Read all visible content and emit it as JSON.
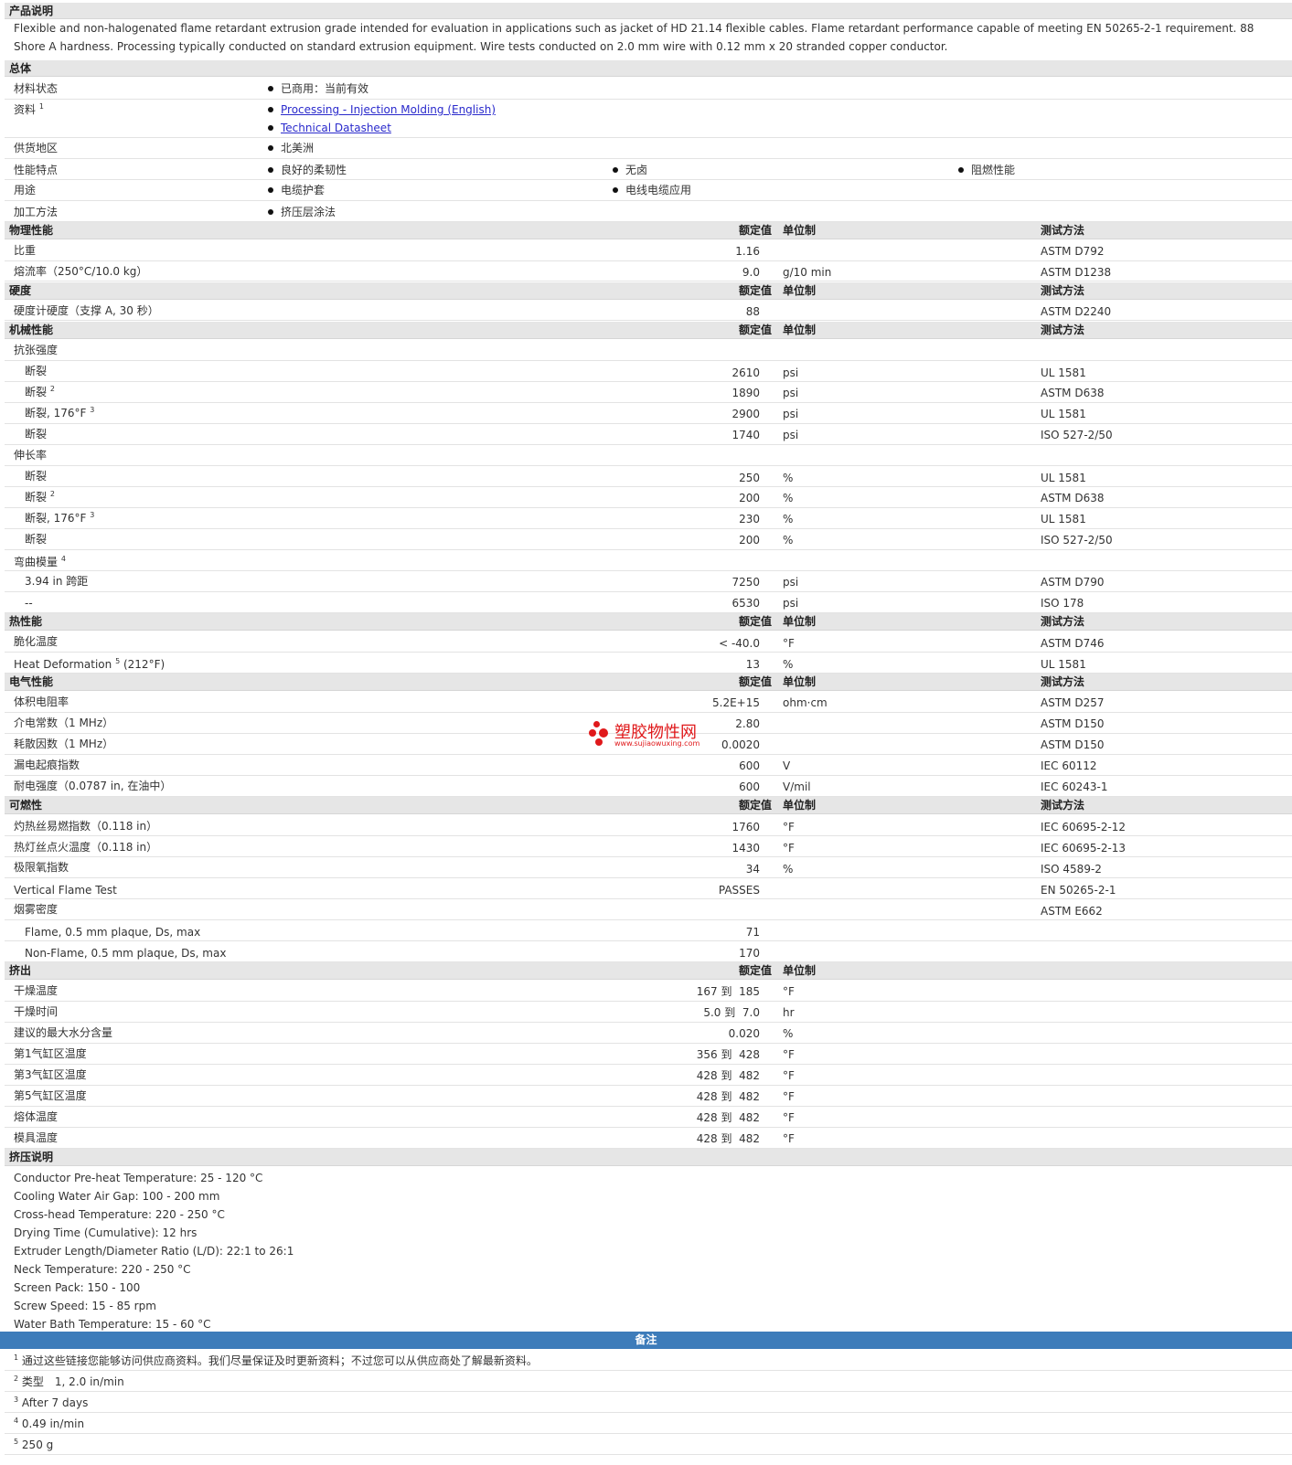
{
  "desc_header": "产品说明",
  "description": "Flexible and non-halogenated flame retardant extrusion grade intended for evaluation in applications such as jacket of HD 21.14 flexible cables. Flame retardant performance capable of meeting EN 50265-2-1 requirement. 88 Shore A hardness. Processing typically conducted on standard extrusion equipment. Wire tests conducted on 2.0 mm wire with 0.12 mm x 20 stranded copper conductor.",
  "general": {
    "title": "总体",
    "status_label": "材料状态",
    "status_value": "已商用：当前有效",
    "docs_label": "资料",
    "docs_sup": "1",
    "doc1": "Processing - Injection Molding (English)",
    "doc2": "Technical Datasheet",
    "region_label": "供货地区",
    "region_value": "北美洲",
    "features_label": "性能特点",
    "feature1": "良好的柔韧性",
    "feature2": "无卤",
    "feature3": "阻燃性能",
    "uses_label": "用途",
    "use1": "电缆护套",
    "use2": "电线电缆应用",
    "method_label": "加工方法",
    "method_value": "挤压层涂法"
  },
  "cols": {
    "nominal": "额定值",
    "unit": "单位制",
    "test": "测试方法"
  },
  "physical": {
    "title": "物理性能",
    "sg": {
      "label": "比重",
      "value": "1.16",
      "test": "ASTM D792"
    },
    "mfr": {
      "label": "熔流率（250°C/10.0 kg）",
      "value": "9.0",
      "unit": "g/10 min",
      "test": "ASTM D1238"
    }
  },
  "hardness": {
    "title": "硬度",
    "shore": {
      "label": "硬度计硬度（支撑 A, 30 秒）",
      "value": "88",
      "test": "ASTM D2240"
    }
  },
  "mechanical": {
    "title": "机械性能",
    "tensile": "抗张强度",
    "t1": {
      "label": "断裂",
      "value": "2610",
      "unit": "psi",
      "test": "UL 1581"
    },
    "t2": {
      "label": "断裂",
      "sup": "2",
      "value": "1890",
      "unit": "psi",
      "test": "ASTM D638"
    },
    "t3": {
      "label": "断裂, 176°F",
      "sup": "3",
      "value": "2900",
      "unit": "psi",
      "test": "UL 1581"
    },
    "t4": {
      "label": "断裂",
      "value": "1740",
      "unit": "psi",
      "test": "ISO 527-2/50"
    },
    "elong": "伸长率",
    "e1": {
      "label": "断裂",
      "value": "250",
      "unit": "%",
      "test": "UL 1581"
    },
    "e2": {
      "label": "断裂",
      "sup": "2",
      "value": "200",
      "unit": "%",
      "test": "ASTM D638"
    },
    "e3": {
      "label": "断裂, 176°F",
      "sup": "3",
      "value": "230",
      "unit": "%",
      "test": "UL 1581"
    },
    "e4": {
      "label": "断裂",
      "value": "200",
      "unit": "%",
      "test": "ISO 527-2/50"
    },
    "flex": "弯曲模量",
    "flex_sup": "4",
    "f1": {
      "label": "3.94 in 跨距",
      "value": "7250",
      "unit": "psi",
      "test": "ASTM D790"
    },
    "f2": {
      "label": "--",
      "value": "6530",
      "unit": "psi",
      "test": "ISO 178"
    }
  },
  "thermal": {
    "title": "热性能",
    "brittle": {
      "label": "脆化温度",
      "value": "< -40.0",
      "unit": "°F",
      "test": "ASTM D746"
    },
    "hd": {
      "label": "Heat Deformation",
      "sup": "5",
      "label2": "(212°F)",
      "value": "13",
      "unit": "%",
      "test": "UL 1581"
    }
  },
  "electrical": {
    "title": "电气性能",
    "vr": {
      "label": "体积电阻率",
      "value": "5.2E+15",
      "unit": "ohm·cm",
      "test": "ASTM D257"
    },
    "dc": {
      "label": "介电常数（1 MHz）",
      "value": "2.80",
      "test": "ASTM D150"
    },
    "df": {
      "label": "耗散因数（1 MHz）",
      "value": "0.0020",
      "test": "ASTM D150"
    },
    "cti": {
      "label": "漏电起痕指数",
      "value": "600",
      "unit": "V",
      "test": "IEC 60112"
    },
    "ds": {
      "label": "耐电强度（0.0787 in, 在油中）",
      "value": "600",
      "unit": "V/mil",
      "test": "IEC 60243-1"
    }
  },
  "flammability": {
    "title": "可燃性",
    "gwfi": {
      "label": "灼热丝易燃指数（0.118 in）",
      "value": "1760",
      "unit": "°F",
      "test": "IEC 60695-2-12"
    },
    "gwit": {
      "label": "热灯丝点火温度（0.118 in）",
      "value": "1430",
      "unit": "°F",
      "test": "IEC 60695-2-13"
    },
    "loi": {
      "label": "极限氧指数",
      "value": "34",
      "unit": "%",
      "test": "ISO 4589-2"
    },
    "vft": {
      "label": "Vertical Flame Test",
      "value": "PASSES",
      "test": "EN 50265-2-1"
    },
    "smoke": {
      "label": "烟雾密度",
      "test": "ASTM E662"
    },
    "s1": {
      "label": "Flame, 0.5 mm plaque, Ds, max",
      "value": "71"
    },
    "s2": {
      "label": "Non-Flame, 0.5 mm plaque, Ds, max",
      "value": "170"
    }
  },
  "extrusion": {
    "title": "挤出",
    "to": "到",
    "dt": {
      "label": "干燥温度",
      "v1": "167",
      "v2": "185",
      "unit": "°F"
    },
    "dtime": {
      "label": "干燥时间",
      "v1": "5.0",
      "v2": "7.0",
      "unit": "hr"
    },
    "moist": {
      "label": "建议的最大水分含量",
      "value": "0.020",
      "unit": "%"
    },
    "z1": {
      "label": "第1气缸区温度",
      "v1": "356",
      "v2": "428",
      "unit": "°F"
    },
    "z3": {
      "label": "第3气缸区温度",
      "v1": "428",
      "v2": "482",
      "unit": "°F"
    },
    "z5": {
      "label": "第5气缸区温度",
      "v1": "428",
      "v2": "482",
      "unit": "°F"
    },
    "melt": {
      "label": "熔体温度",
      "v1": "428",
      "v2": "482",
      "unit": "°F"
    },
    "die": {
      "label": "模具温度",
      "v1": "428",
      "v2": "482",
      "unit": "°F"
    }
  },
  "extrusion_notes": {
    "title": "挤压说明",
    "lines": [
      "Conductor Pre-heat Temperature: 25 - 120 °C",
      "Cooling Water Air Gap: 100 - 200 mm",
      "Cross-head Temperature: 220 - 250 °C",
      "Drying Time (Cumulative): 12 hrs",
      "Extruder Length/Diameter Ratio (L/D): 22:1 to 26:1",
      "Neck Temperature: 220 - 250 °C",
      "Screen Pack: 150 - 100",
      "Screw Speed: 15 - 85 rpm",
      "Water Bath Temperature: 15 - 60 °C"
    ]
  },
  "notes": {
    "title": "备注",
    "n1": {
      "num": "1",
      "text": "通过这些链接您能够访问供应商资料。我们尽量保证及时更新资料；不过您可以从供应商处了解最新资料。"
    },
    "n2": {
      "num": "2",
      "text": "类型　1, 2.0 in/min"
    },
    "n3": {
      "num": "3",
      "text": "After 7 days"
    },
    "n4": {
      "num": "4",
      "text": "0.49 in/min"
    },
    "n5": {
      "num": "5",
      "text": "250 g"
    }
  },
  "watermark": {
    "title": "塑胶物性网",
    "url": "www.sujiaowuxing.com"
  },
  "colors": {
    "header_bg": "#e6e6e6",
    "notes_bar": "#3d7cba",
    "link": "#2a2acc",
    "watermark": "#e0191b"
  }
}
